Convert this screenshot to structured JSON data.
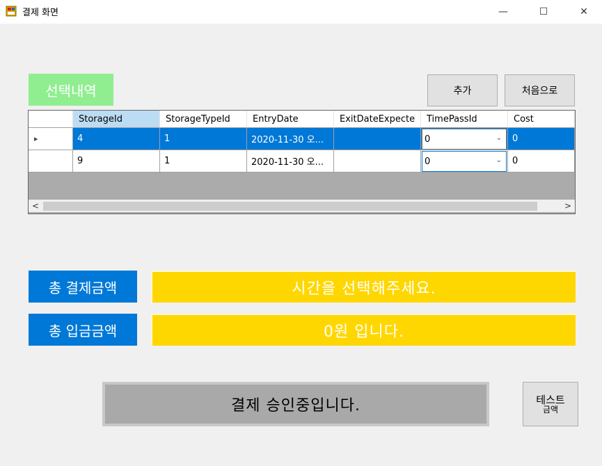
{
  "window": {
    "title": "결제 화면",
    "icon": "app-form-icon",
    "minimize_glyph": "—",
    "maximize_glyph": "☐",
    "close_glyph": "✕"
  },
  "selection": {
    "label": "선택내역"
  },
  "buttons": {
    "add": "추가",
    "home": "처음으로",
    "test_line1": "테스트",
    "test_line2": "금액"
  },
  "grid": {
    "columns": [
      "StorageId",
      "StorageTypeId",
      "EntryDate",
      "ExitDateExpecte",
      "TimePassId",
      "Cost"
    ],
    "rows": [
      {
        "selected": true,
        "row_marker": "▸",
        "storage_id": "4",
        "storage_type_id": "1",
        "entry_date": "2020-11-30 오...",
        "exit_date": "",
        "time_pass_id": "0",
        "cost": "0"
      },
      {
        "selected": false,
        "row_marker": "",
        "storage_id": "9",
        "storage_type_id": "1",
        "entry_date": "2020-11-30 오...",
        "exit_date": "",
        "time_pass_id": "0",
        "cost": "0"
      }
    ],
    "scroll_left": "<",
    "scroll_right": ">"
  },
  "payment": {
    "total_pay_label": "총 결제금액",
    "total_pay_value": "시간을 선택해주세요.",
    "total_deposit_label": "총 입금금액",
    "total_deposit_value": "0원 입니다."
  },
  "status": {
    "text": "결제 승인중입니다."
  },
  "colors": {
    "accent_blue": "#0078d7",
    "yellow": "#ffd700",
    "green": "#90ee90",
    "status_gray": "#a9a9a9"
  }
}
